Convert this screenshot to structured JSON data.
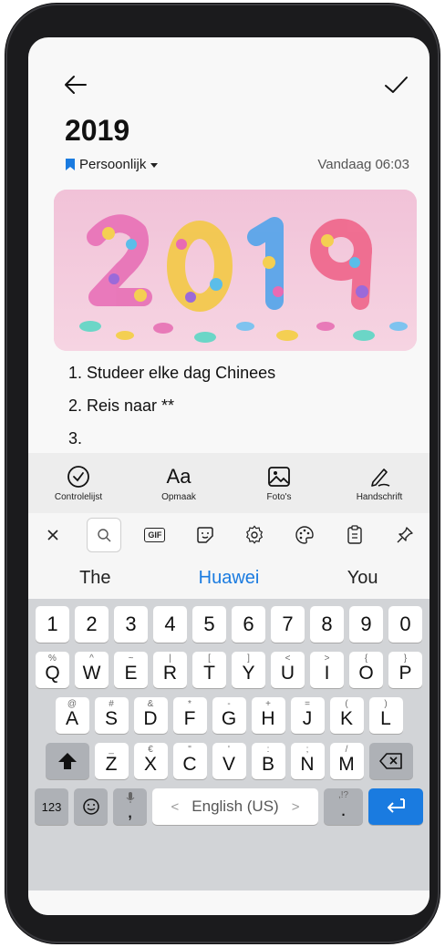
{
  "note": {
    "title": "2019",
    "category": "Persoonlijk",
    "date": "Vandaag 06:03",
    "list": [
      "1. Studeer elke dag Chinees",
      "2. Reis naar **",
      "3."
    ]
  },
  "toolbar": {
    "items": [
      {
        "label": "Controlelijst",
        "icon": "checklist-icon"
      },
      {
        "label": "Opmaak",
        "icon": "format-icon",
        "glyph": "Aa"
      },
      {
        "label": "Foto's",
        "icon": "photo-icon"
      },
      {
        "label": "Handschrift",
        "icon": "handwriting-icon"
      }
    ]
  },
  "keyboard": {
    "top_icons": [
      "close-icon",
      "search-icon",
      "gif-icon",
      "sticker-icon",
      "settings-icon",
      "palette-icon",
      "clipboard-icon",
      "pin-icon"
    ],
    "gif_label": "GIF",
    "suggestions": [
      "The",
      "Huawei",
      "You"
    ],
    "row_numbers": [
      "1",
      "2",
      "3",
      "4",
      "5",
      "6",
      "7",
      "8",
      "9",
      "0"
    ],
    "row1": [
      {
        "main": "Q",
        "sub": "%"
      },
      {
        "main": "W",
        "sub": "^"
      },
      {
        "main": "E",
        "sub": "~"
      },
      {
        "main": "R",
        "sub": "|"
      },
      {
        "main": "T",
        "sub": "["
      },
      {
        "main": "Y",
        "sub": "]"
      },
      {
        "main": "U",
        "sub": "<"
      },
      {
        "main": "I",
        "sub": ">"
      },
      {
        "main": "O",
        "sub": "{"
      },
      {
        "main": "P",
        "sub": "}"
      }
    ],
    "row2": [
      {
        "main": "A",
        "sub": "@"
      },
      {
        "main": "S",
        "sub": "#"
      },
      {
        "main": "D",
        "sub": "&"
      },
      {
        "main": "F",
        "sub": "*"
      },
      {
        "main": "G",
        "sub": "-"
      },
      {
        "main": "H",
        "sub": "+"
      },
      {
        "main": "J",
        "sub": "="
      },
      {
        "main": "K",
        "sub": "("
      },
      {
        "main": "L",
        "sub": ")"
      }
    ],
    "row3": [
      {
        "main": "Z",
        "sub": "_"
      },
      {
        "main": "X",
        "sub": "€"
      },
      {
        "main": "C",
        "sub": "\""
      },
      {
        "main": "V",
        "sub": "'"
      },
      {
        "main": "B",
        "sub": ":"
      },
      {
        "main": "N",
        "sub": ";"
      },
      {
        "main": "M",
        "sub": "/"
      }
    ],
    "key_123": "123",
    "comma": ",",
    "period": ".",
    "period_sub": ",!?",
    "space_label": "English (US)",
    "space_left": "<",
    "space_right": ">",
    "accent_color": "#1a7be0"
  }
}
